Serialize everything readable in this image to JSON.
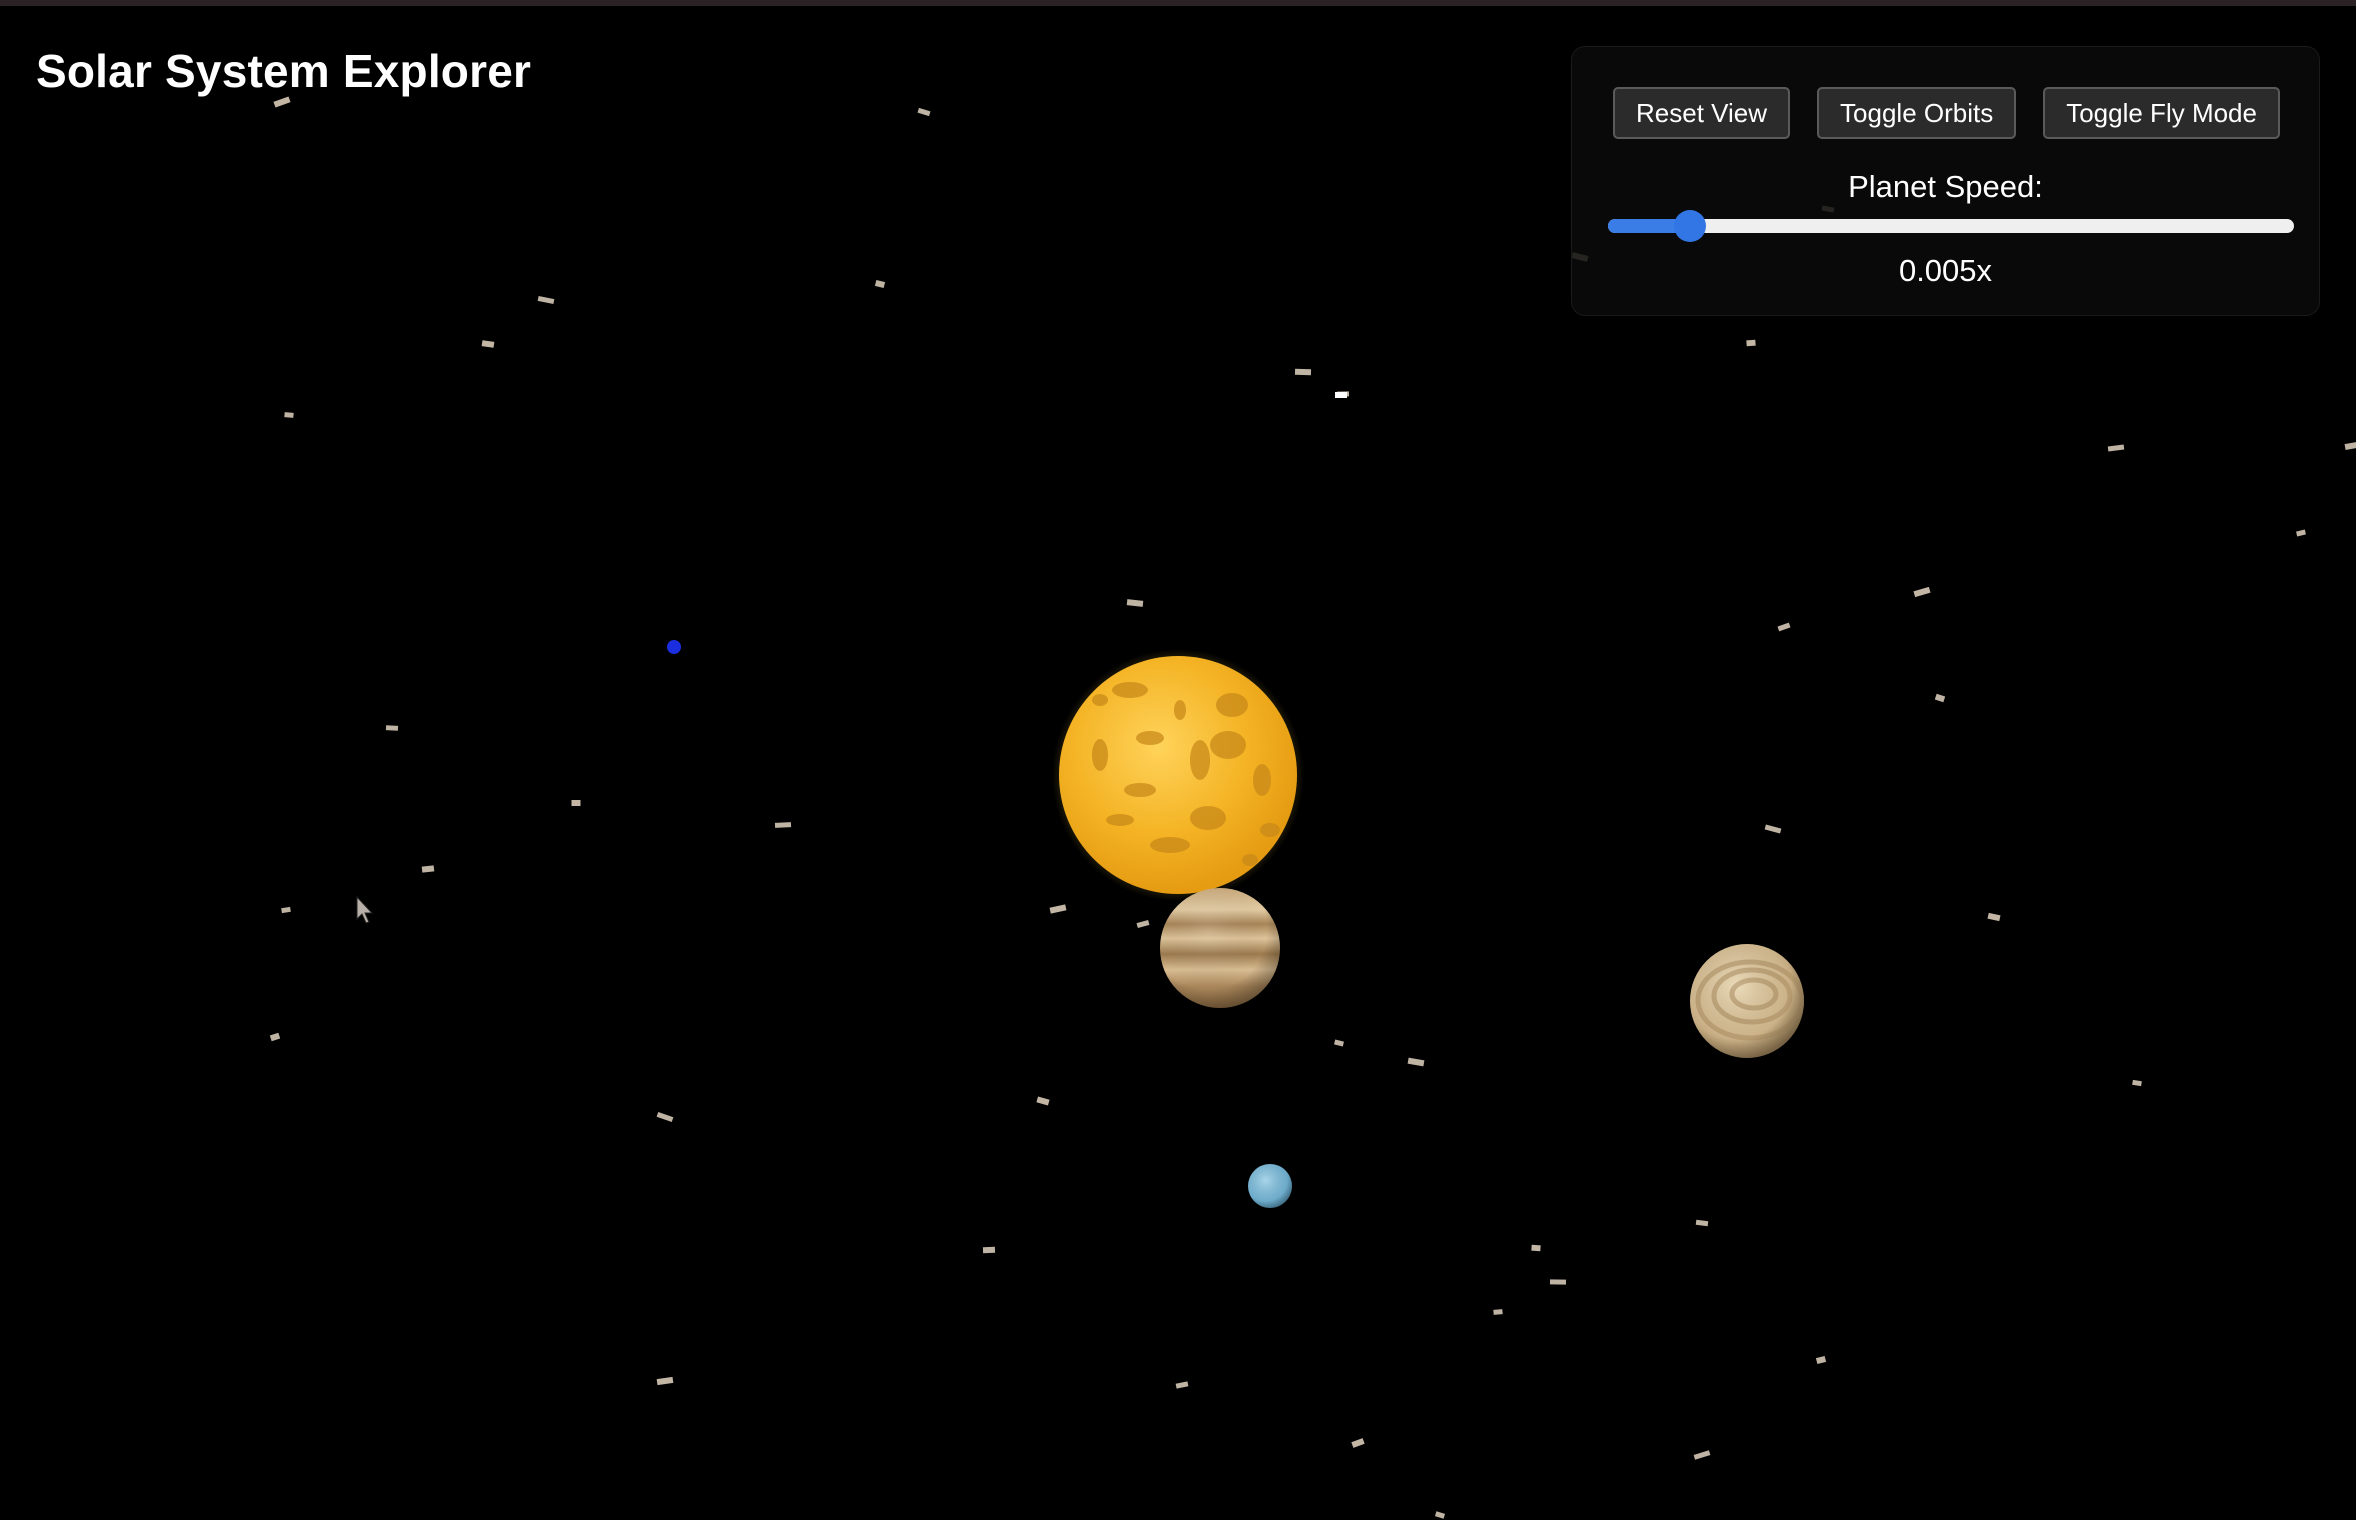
{
  "header": {
    "title": "Solar System Explorer"
  },
  "controls": {
    "reset_view_label": "Reset View",
    "toggle_orbits_label": "Toggle Orbits",
    "toggle_fly_mode_label": "Toggle Fly Mode",
    "speed_label": "Planet Speed:",
    "speed_value": "0.005x",
    "speed_slider_fraction": 0.12
  },
  "scene": {
    "background_color": "#000000",
    "accent_color": "#3a7de6",
    "bodies": [
      "sun",
      "jupiter-like-planet",
      "saturn-like-planet",
      "uranus-like-planet",
      "small-blue-planet"
    ]
  }
}
